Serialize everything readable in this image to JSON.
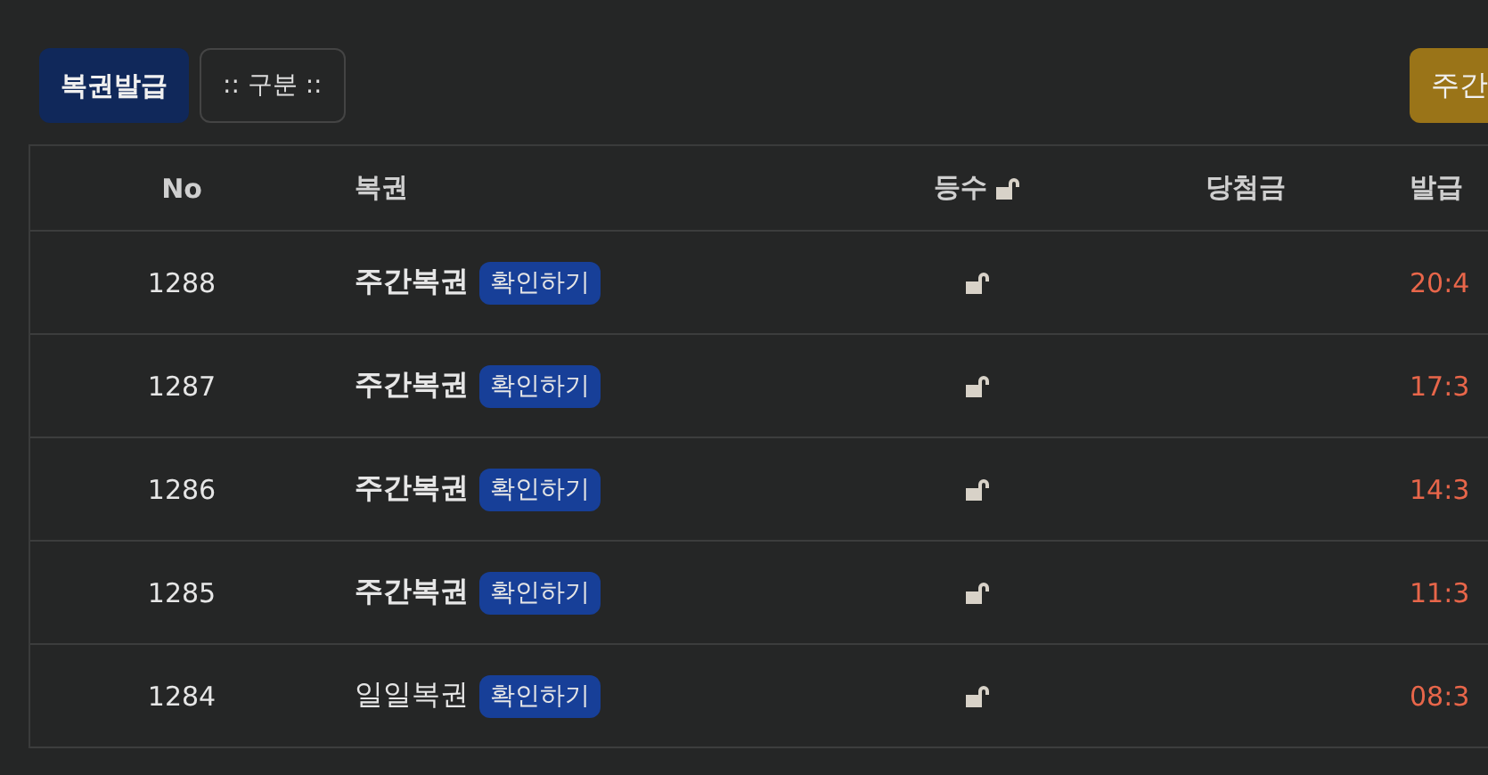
{
  "toolbar": {
    "issue_button": "복권발급",
    "category_select": ":: 구분 ::",
    "weekly_button": "주간"
  },
  "table": {
    "columns": [
      "No",
      "복권",
      "등수",
      "당첨금",
      "발급"
    ],
    "rows": [
      {
        "no": "1288",
        "name": "주간복권",
        "kind": "weekly",
        "check": "확인하기",
        "time": "20:4"
      },
      {
        "no": "1287",
        "name": "주간복권",
        "kind": "weekly",
        "check": "확인하기",
        "time": "17:3"
      },
      {
        "no": "1286",
        "name": "주간복권",
        "kind": "weekly",
        "check": "확인하기",
        "time": "14:3"
      },
      {
        "no": "1285",
        "name": "주간복권",
        "kind": "weekly",
        "check": "확인하기",
        "time": "11:3"
      },
      {
        "no": "1284",
        "name": "일일복권",
        "kind": "daily",
        "check": "확인하기",
        "time": "08:3"
      }
    ]
  }
}
